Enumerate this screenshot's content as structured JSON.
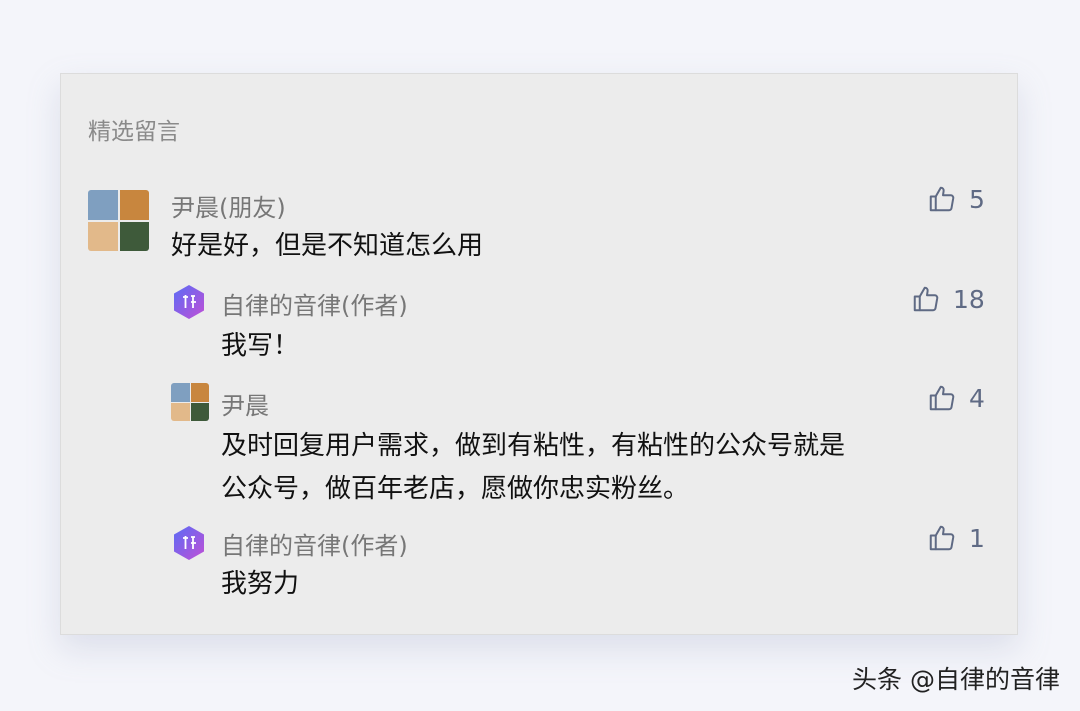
{
  "section": {
    "title": "精选留言"
  },
  "comments": [
    {
      "name": "尹晨(朋友)",
      "text": "好是好，但是不知道怎么用",
      "likes": "5",
      "avatar": "photo-grid"
    },
    {
      "name": "自律的音律(作者)",
      "text": "我写！",
      "likes": "18",
      "avatar": "author-hexagon-logo"
    },
    {
      "name": "尹晨",
      "text_line1": "及时回复用户需求，做到有粘性，有粘性的公众号就是",
      "text_line2": "公众号，做百年老店，愿做你忠实粉丝。",
      "likes": "4",
      "avatar": "photo-grid"
    },
    {
      "name": "自律的音律(作者)",
      "text": "我努力",
      "likes": "1",
      "avatar": "author-hexagon-logo"
    }
  ],
  "watermark": "头条 @自律的音律",
  "icons": {
    "like": "thumbs-up-icon"
  },
  "colors": {
    "card_bg": "#ececec",
    "page_bg": "#f4f5fa",
    "name": "#777777",
    "like": "#5f6a84"
  }
}
